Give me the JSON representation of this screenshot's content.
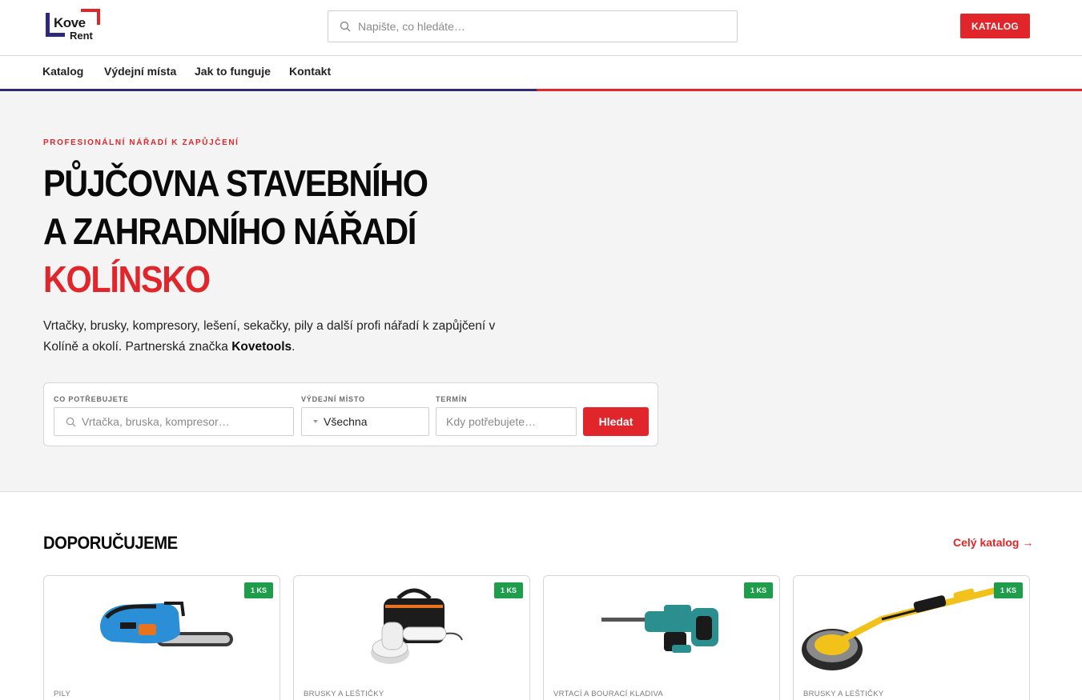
{
  "header": {
    "logo_top": "Kove",
    "logo_bottom": "Rent",
    "search_placeholder": "Napište, co hledáte…",
    "catalog_button": "KATALOG"
  },
  "nav": {
    "items": [
      "Katalog",
      "Výdejní místa",
      "Jak to funguje",
      "Kontakt"
    ]
  },
  "hero": {
    "eyebrow": "PROFESIONÁLNÍ NÁŘADÍ K ZAPŮJČENÍ",
    "title_line1": "PŮJČOVNA STAVEBNÍHO",
    "title_line2": "A ZAHRADNÍHO NÁŘADÍ",
    "title_line3": "KOLÍNSKO",
    "lead_text": "Vrtačky, brusky, kompresory, lešení, sekačky, pily a další profi nářadí k zapůjčení v Kolíně a okolí. Partnerská značka ",
    "lead_brand": "Kovetools",
    "lead_end": "."
  },
  "search_form": {
    "need_label": "CO POTŘEBUJETE",
    "need_placeholder": "Vrtačka, bruska, kompresor…",
    "place_label": "VÝDEJNÍ MÍSTO",
    "place_value": "Všechna",
    "term_label": "TERMÍN",
    "term_placeholder": "Kdy potřebujete…",
    "submit_label": "Hledat"
  },
  "recommended": {
    "title": "DOPORUČUJEME",
    "all_link": "Celý katalog →",
    "cards": [
      {
        "badge": "1 KS",
        "category": "PILY",
        "image": "chainsaw"
      },
      {
        "badge": "1 KS",
        "category": "BRUSKY A LEŠTIČKY",
        "image": "polisher-with-bag"
      },
      {
        "badge": "1 KS",
        "category": "VRTACÍ A BOURACÍ KLADIVA",
        "image": "rotary-hammer"
      },
      {
        "badge": "1 KS",
        "category": "BRUSKY A LEŠTIČKY",
        "image": "drywall-sander"
      }
    ]
  },
  "colors": {
    "brand_red": "#e0262a",
    "brand_blue": "#2e2a7a",
    "badge_green": "#1e9d4a"
  }
}
